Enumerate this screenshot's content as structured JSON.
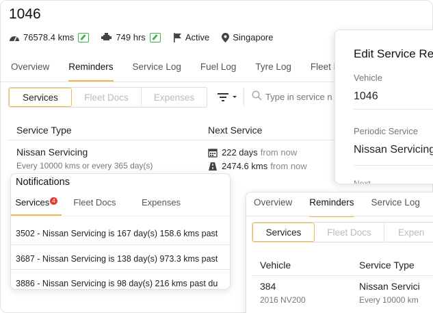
{
  "vehicle": {
    "title": "1046",
    "odometer": "76578.4 kms",
    "hours": "749 hrs",
    "status": "Active",
    "location": "Singapore"
  },
  "tabs": [
    "Overview",
    "Reminders",
    "Service Log",
    "Fuel Log",
    "Tyre Log",
    "Fleet Docs"
  ],
  "segments": [
    "Services",
    "Fleet Docs",
    "Expenses"
  ],
  "search_placeholder": "Type in service n",
  "table": {
    "col1": "Service Type",
    "col2": "Next Service",
    "row": {
      "service": "Nissan Servicing",
      "interval": "Every 10000 kms or every 365 day(s)",
      "days": "222 days",
      "days_suffix": "from now",
      "kms": "2474.6 kms",
      "kms_suffix": "from now"
    }
  },
  "notifications": {
    "title": "Notifications",
    "tabs": [
      "Services",
      "Fleet Docs",
      "Expenses"
    ],
    "badge": "4",
    "items": [
      "3502 - Nissan Servicing is 167 day(s) 158.6 kms past",
      "3687 - Nissan Servicing is 138 day(s) 973.3 kms past",
      "3886 - Nissan Servicing is 98 day(s) 216 kms past du"
    ]
  },
  "edit_panel": {
    "title": "Edit Service Re",
    "vehicle_label": "Vehicle",
    "vehicle_value": "1046",
    "periodic_label": "Periodic Service",
    "periodic_value": "Nissan Servicing",
    "cut_label": "Next ..."
  },
  "reminders_panel": {
    "tabs": [
      "Overview",
      "Reminders",
      "Service Log"
    ],
    "segments": [
      "Services",
      "Fleet Docs",
      "Expen"
    ],
    "col1": "Vehicle",
    "col2": "Service Type",
    "row": {
      "vehicle": "384",
      "model": "2016 NV200",
      "service": "Nissan Servici",
      "interval": "Every 10000 km"
    }
  }
}
